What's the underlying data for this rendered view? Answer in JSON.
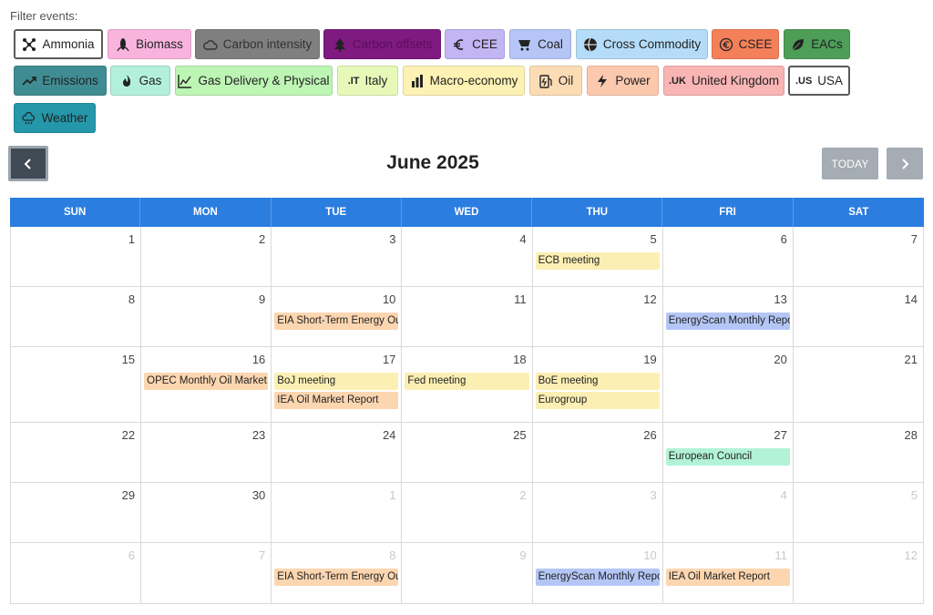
{
  "filter": {
    "label": "Filter events:",
    "chips": [
      {
        "label": "Ammonia",
        "icon": "molecule-icon",
        "bg": "#ffffff",
        "outlined": true
      },
      {
        "label": "Biomass",
        "icon": "corn-icon",
        "bg": "#f9b4de"
      },
      {
        "label": "Carbon intensity",
        "icon": "cloud-icon",
        "bg": "#7f7f7f"
      },
      {
        "label": "Carbon offsets",
        "icon": "tree-icon",
        "bg": "#7e1a80"
      },
      {
        "label": "CEE",
        "icon": "euro-icon",
        "bg": "#c2b5f4"
      },
      {
        "label": "Coal",
        "icon": "cart-icon",
        "bg": "#b4c5f6"
      },
      {
        "label": "Cross Commodity",
        "icon": "globe-icon",
        "bg": "#b4dcf8"
      },
      {
        "label": "CSEE",
        "icon": "euro-circle-icon",
        "bg": "#f4805a"
      },
      {
        "label": "EACs",
        "icon": "leaf-icon",
        "bg": "#4e9e58"
      },
      {
        "label": "Emissions",
        "icon": "trend-up-icon",
        "bg": "#3f8d93"
      },
      {
        "label": "Gas",
        "icon": "flame-icon",
        "bg": "#b2f0dc"
      },
      {
        "label": "Gas Delivery & Physical",
        "icon": "line-chart-icon",
        "bg": "#bdf5b4"
      },
      {
        "label": "Italy",
        "prefix": ".IT",
        "icon": "",
        "bg": "#e6f9b8"
      },
      {
        "label": "Macro-economy",
        "icon": "bar-chart-icon",
        "bg": "#fdf2b4"
      },
      {
        "label": "Oil",
        "icon": "fuel-icon",
        "bg": "#fcdcb4"
      },
      {
        "label": "Power",
        "icon": "bolt-icon",
        "bg": "#fcc8ae"
      },
      {
        "label": "United Kingdom",
        "prefix": ".UK",
        "icon": "",
        "bg": "#f9b4b4"
      },
      {
        "label": "USA",
        "prefix": ".US",
        "icon": "",
        "bg": "#ffffff",
        "outlined": true
      },
      {
        "label": "Weather",
        "icon": "weather-icon",
        "bg": "#2497a9"
      }
    ]
  },
  "calendar": {
    "title": "June 2025",
    "today_label": "TODAY",
    "weekdays": [
      "SUN",
      "MON",
      "TUE",
      "WED",
      "THU",
      "FRI",
      "SAT"
    ],
    "weeks": [
      [
        {
          "d": "1",
          "other": false,
          "events": []
        },
        {
          "d": "2",
          "other": false,
          "events": []
        },
        {
          "d": "3",
          "other": false,
          "events": []
        },
        {
          "d": "4",
          "other": false,
          "events": []
        },
        {
          "d": "5",
          "other": false,
          "events": [
            {
              "title": "ECB meeting",
              "color": "#fbefb3"
            }
          ]
        },
        {
          "d": "6",
          "other": false,
          "events": []
        },
        {
          "d": "7",
          "other": false,
          "events": []
        }
      ],
      [
        {
          "d": "8",
          "other": false,
          "events": []
        },
        {
          "d": "9",
          "other": false,
          "events": []
        },
        {
          "d": "10",
          "other": false,
          "events": [
            {
              "title": "EIA Short-Term Energy Outlook",
              "color": "#fcd6b0"
            }
          ]
        },
        {
          "d": "11",
          "other": false,
          "events": []
        },
        {
          "d": "12",
          "other": false,
          "events": []
        },
        {
          "d": "13",
          "other": false,
          "events": [
            {
              "title": "EnergyScan Monthly Report",
              "color": "#b4c6f5"
            }
          ]
        },
        {
          "d": "14",
          "other": false,
          "events": []
        }
      ],
      [
        {
          "d": "15",
          "other": false,
          "events": []
        },
        {
          "d": "16",
          "other": false,
          "events": [
            {
              "title": "OPEC Monthly Oil Market Report",
              "color": "#fcd6b0"
            }
          ]
        },
        {
          "d": "17",
          "other": false,
          "events": [
            {
              "title": "BoJ meeting",
              "color": "#fbefb3"
            },
            {
              "title": "IEA Oil Market Report",
              "color": "#fcd6b0"
            }
          ]
        },
        {
          "d": "18",
          "other": false,
          "events": [
            {
              "title": "Fed meeting",
              "color": "#fbefb3"
            }
          ]
        },
        {
          "d": "19",
          "other": false,
          "events": [
            {
              "title": "BoE meeting",
              "color": "#fbefb3"
            },
            {
              "title": "Eurogroup",
              "color": "#fbefb3"
            }
          ]
        },
        {
          "d": "20",
          "other": false,
          "events": []
        },
        {
          "d": "21",
          "other": false,
          "events": []
        }
      ],
      [
        {
          "d": "22",
          "other": false,
          "events": []
        },
        {
          "d": "23",
          "other": false,
          "events": []
        },
        {
          "d": "24",
          "other": false,
          "events": []
        },
        {
          "d": "25",
          "other": false,
          "events": []
        },
        {
          "d": "26",
          "other": false,
          "events": []
        },
        {
          "d": "27",
          "other": false,
          "events": [
            {
              "title": "European Council",
              "color": "#b2f2d6"
            }
          ]
        },
        {
          "d": "28",
          "other": false,
          "events": []
        }
      ],
      [
        {
          "d": "29",
          "other": false,
          "events": []
        },
        {
          "d": "30",
          "other": false,
          "events": []
        },
        {
          "d": "1",
          "other": true,
          "events": []
        },
        {
          "d": "2",
          "other": true,
          "events": []
        },
        {
          "d": "3",
          "other": true,
          "events": []
        },
        {
          "d": "4",
          "other": true,
          "events": []
        },
        {
          "d": "5",
          "other": true,
          "events": []
        }
      ],
      [
        {
          "d": "6",
          "other": true,
          "events": []
        },
        {
          "d": "7",
          "other": true,
          "events": []
        },
        {
          "d": "8",
          "other": true,
          "events": [
            {
              "title": "EIA Short-Term Energy Outlook",
              "color": "#fcd6b0"
            }
          ]
        },
        {
          "d": "9",
          "other": true,
          "events": []
        },
        {
          "d": "10",
          "other": true,
          "events": [
            {
              "title": "EnergyScan Monthly Report",
              "color": "#b4c6f5"
            }
          ]
        },
        {
          "d": "11",
          "other": true,
          "events": [
            {
              "title": "IEA Oil Market Report",
              "color": "#fcd6b0"
            }
          ]
        },
        {
          "d": "12",
          "other": true,
          "events": []
        }
      ]
    ]
  }
}
